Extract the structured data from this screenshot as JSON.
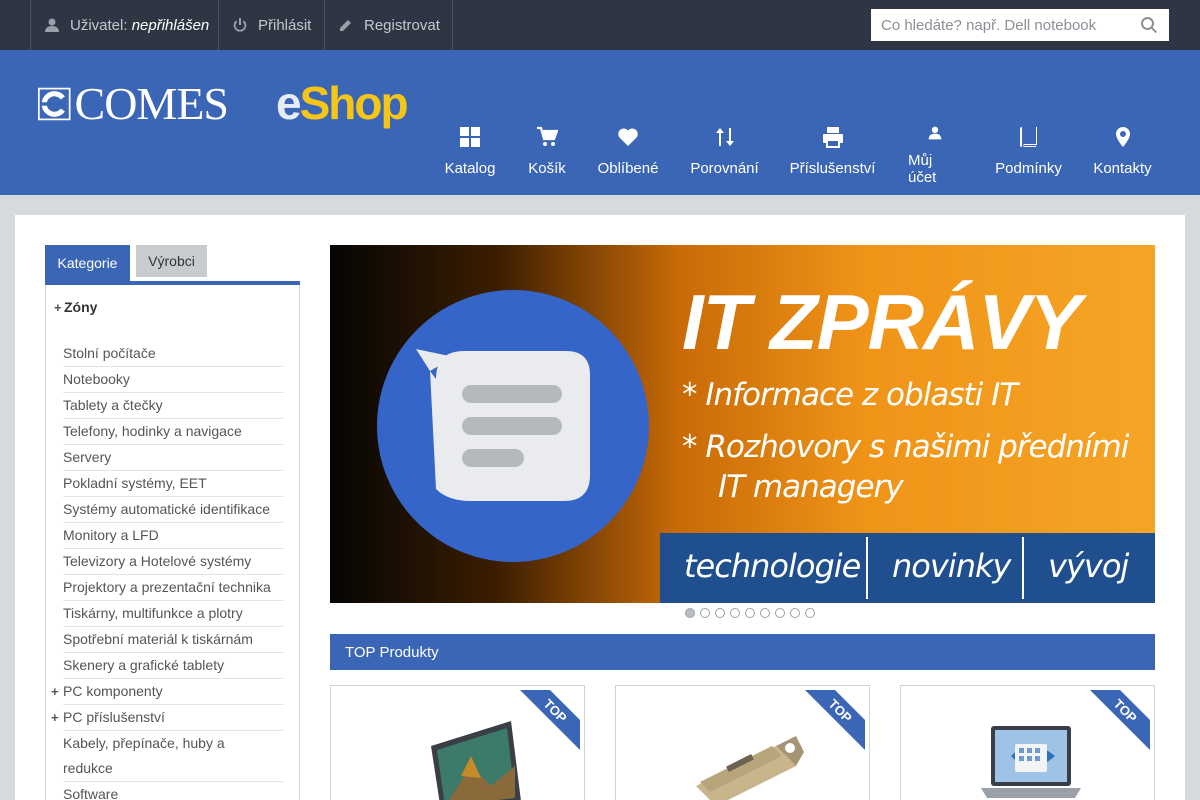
{
  "topbar": {
    "user_label": "Uživatel:",
    "user_status": "nepřihlášen",
    "login": "Přihlásit",
    "register": "Registrovat",
    "search_placeholder": "Co hledáte? např. Dell notebook"
  },
  "header": {
    "logo_comes": "COMES",
    "logo_eshop_e": "e",
    "logo_eshop_rest": "Shop",
    "nav": [
      "Katalog",
      "Košík",
      "Oblíbené",
      "Porovnání",
      "Příslušenství",
      "Můj účet",
      "Podmínky",
      "Kontakty"
    ]
  },
  "sidebar": {
    "tab_active": "Kategorie",
    "tab_inactive": "Výrobci",
    "zone_title": "Zóny",
    "categories": [
      "Stolní počítače",
      "Notebooky",
      "Tablety a čtečky",
      "Telefony, hodinky a navigace",
      "Servery",
      "Pokladní systémy, EET",
      "Systémy automatické identifikace",
      "Monitory a LFD",
      "Televizory a Hotelové systémy",
      "Projektory a prezentační technika",
      "Tiskárny, multifunkce a plotry",
      "Spotřební materiál k tiskárnám",
      "Skenery a grafické tablety",
      "PC komponenty",
      "PC příslušenství",
      "Kabely, přepínače, huby a",
      "redukce",
      "Software"
    ]
  },
  "banner": {
    "title": "IT ZPRÁVY",
    "bullet1": "* Informace z oblasti IT",
    "bullet2a": "* Rozhovory s našimi předními",
    "bullet2b": "IT managery",
    "tags": [
      "technologie",
      "novinky",
      "vývoj"
    ],
    "slide_count": 9,
    "active_slide": 1
  },
  "top_products": {
    "heading": "TOP Produkty",
    "ribbon": "TOP"
  },
  "colors": {
    "topbar": "#2e3543",
    "brand_blue": "#3b66b5",
    "eshop_yellow": "#f5c518"
  }
}
